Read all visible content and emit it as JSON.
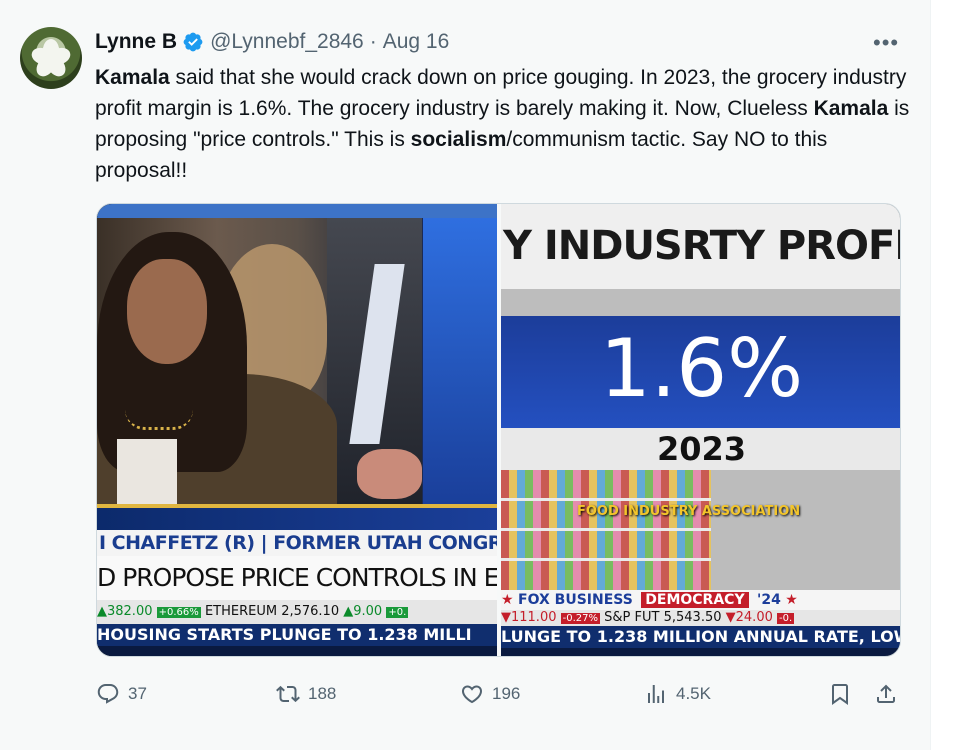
{
  "tweet": {
    "author_name": "Lynne B",
    "handle": "@Lynnebf_2846",
    "separator": "·",
    "date": "Aug 16",
    "more_label": "•••",
    "text": {
      "s1_bold": "Kamala",
      "s1": " said that she would crack down on price gouging. In 2023, the grocery industry profit margin is 1.6%. The grocery industry is barely making it. Now, Clueless ",
      "s2_bold": "Kamala",
      "s2": " is proposing \"price controls.\" This is ",
      "s3_bold": "socialism",
      "s3": "/communism tactic. Say NO to this proposal!!"
    }
  },
  "media": {
    "left": {
      "chyron_name": "I CHAFFETZ (R) | FORMER UTAH CONGRESSMA",
      "chyron_headline": "D PROPOSE PRICE CONTROLS IN ECONOMIC PLA",
      "ticker": {
        "v1": "▲382.00",
        "b1": "+0.66%",
        "t2": "ETHEREUM",
        "v2": "2,576.10",
        "v3": "▲9.00",
        "b3": "+0."
      },
      "crawl": "HOUSING STARTS PLUNGE TO 1.238 MILLI"
    },
    "right": {
      "header": "Y INDUSRTY PROFIT M",
      "percent": "1.6%",
      "year": "2023",
      "source": "FOOD INDUSTRY ASSOCIATION",
      "network": "FOX BUSINESS",
      "democracy": "DEMOCRACY",
      "democracy_year": "'24",
      "star": "★",
      "ticker": {
        "v1": "▼111.00",
        "b1": "-0.27%",
        "t2": "S&P FUT",
        "v2": "5,543.50",
        "v3": "▼24.00",
        "b3": "-0."
      },
      "crawl": "LUNGE TO 1.238 MILLION ANNUAL RATE, LOW"
    }
  },
  "actions": {
    "replies": "37",
    "reposts": "188",
    "likes": "196",
    "views": "4.5K"
  },
  "colors": {
    "accent": "#1d9bf0",
    "muted": "#536471",
    "background": "#f7f9f9"
  }
}
